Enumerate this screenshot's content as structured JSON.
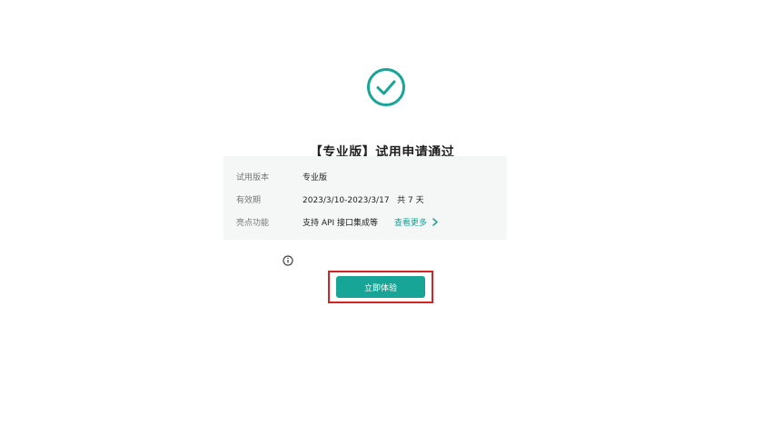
{
  "result": {
    "title": "【专业版】试用申请通过",
    "icon": "check-circle-icon",
    "accent_color": "#17a597"
  },
  "details": {
    "rows": [
      {
        "label": "试用版本",
        "value": "专业版"
      },
      {
        "label": "有效期",
        "value": "2023/3/10-2023/3/17   共 7 天"
      },
      {
        "label": "亮点功能",
        "value": "支持 API 接口集成等",
        "link": "查看更多"
      }
    ]
  },
  "actions": {
    "primary_label": "立即体验"
  }
}
